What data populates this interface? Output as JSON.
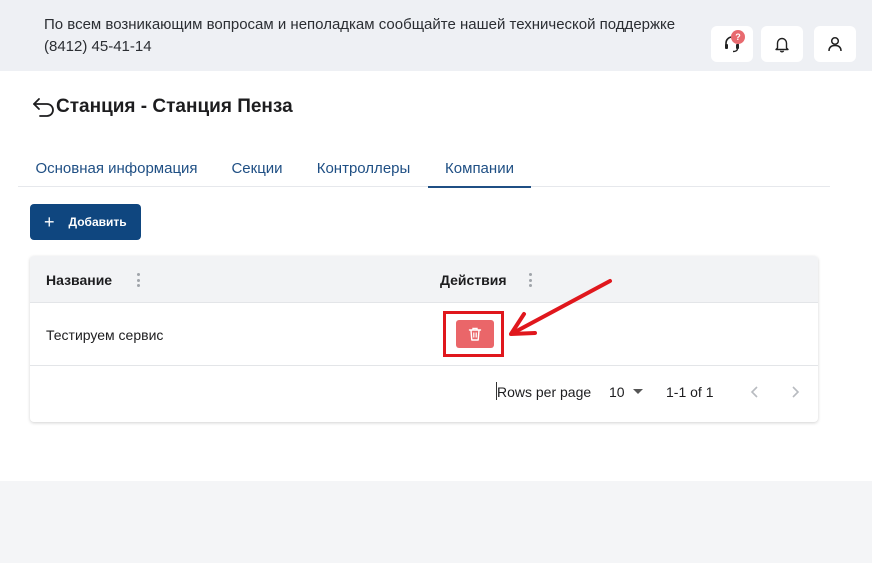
{
  "header": {
    "support_line1": "По всем возникающим вопросам и неполадкам сообщайте нашей технической поддержке",
    "support_line2": "(8412) 45-41-14",
    "support_badge": "?",
    "icons": [
      "headset-icon",
      "bell-icon",
      "user-icon"
    ]
  },
  "page": {
    "title": "Станция - Станция Пенза"
  },
  "tabs": [
    {
      "label": "Основная информация",
      "active": false
    },
    {
      "label": "Секции",
      "active": false
    },
    {
      "label": "Контроллеры",
      "active": false
    },
    {
      "label": "Компании",
      "active": true
    }
  ],
  "toolbar": {
    "add_label": "Добавить"
  },
  "table": {
    "columns": [
      "Название",
      "Действия"
    ],
    "rows": [
      {
        "name": "Тестируем сервис"
      }
    ]
  },
  "pagination": {
    "rows_per_page_label": "Rows per page",
    "rows_per_page_value": "10",
    "range": "1-1 of 1"
  },
  "colors": {
    "primary": "#0f467f",
    "tab_text": "#1f4f84",
    "delete": "#ea6669",
    "annotation": "#e0171d"
  }
}
